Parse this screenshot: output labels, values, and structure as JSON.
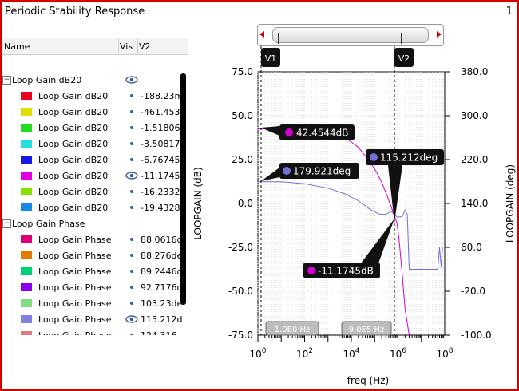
{
  "window": {
    "title": "Periodic Stability Response",
    "number": "1"
  },
  "tree": {
    "columns": {
      "name": "Name",
      "vis": "Vis",
      "v2": "V2"
    },
    "groups": [
      {
        "label": "Loop Gain dB20",
        "items": [
          {
            "label": "Loop Gain dB20",
            "color": "#e8001e",
            "value": "-188.23m"
          },
          {
            "label": "Loop Gain dB20",
            "color": "#e0e000",
            "value": "-461.453"
          },
          {
            "label": "Loop Gain dB20",
            "color": "#22dd22",
            "value": "-1.51806"
          },
          {
            "label": "Loop Gain dB20",
            "color": "#22e0e0",
            "value": "-3.50817"
          },
          {
            "label": "Loop Gain dB20",
            "color": "#1a1ae8",
            "value": "-6.76745"
          },
          {
            "label": "Loop Gain dB20",
            "color": "#e000e0",
            "value": "-11.1745c",
            "visible": true
          },
          {
            "label": "Loop Gain dB20",
            "color": "#88e000",
            "value": "-16.2332c"
          },
          {
            "label": "Loop Gain dB20",
            "color": "#1a88e8",
            "value": "-19.4328"
          }
        ]
      },
      {
        "label": "Loop Gain Phase",
        "items": [
          {
            "label": "Loop Gain Phase",
            "color": "#e0007a",
            "value": "88.0616d"
          },
          {
            "label": "Loop Gain Phase",
            "color": "#e07a00",
            "value": "88.276de"
          },
          {
            "label": "Loop Gain Phase",
            "color": "#00d07a",
            "value": "89.2446d"
          },
          {
            "label": "Loop Gain Phase",
            "color": "#8a00e8",
            "value": "92.7176d"
          },
          {
            "label": "Loop Gain Phase",
            "color": "#80e080",
            "value": "103.23de"
          },
          {
            "label": "Loop Gain Phase",
            "color": "#8080e0",
            "value": "115.212d",
            "visible": true
          },
          {
            "label": "Loop Gain Phase",
            "color": "#e07a7a",
            "value": "124.316"
          }
        ]
      }
    ]
  },
  "plot": {
    "markers": {
      "v1": "V1",
      "v2": "V2"
    },
    "labels": {
      "gain_low": "42.4544dB",
      "phase_low": "179.921deg",
      "phase_high": "115.212deg",
      "gain_high": "-11.1745dB",
      "scroll_left": "1.0E0 Hz",
      "scroll_right": "9.0E5 Hz"
    },
    "colors": {
      "gain": "#d000d0",
      "phase": "#7070d8"
    }
  },
  "chart_data": {
    "type": "line",
    "xlabel": "freq (Hz)",
    "ylabel": "LOOPGAIN (dB)",
    "y2label": "LOOPGAIN (deg)",
    "xscale": "log",
    "xlim": [
      1,
      100000000
    ],
    "ylim": [
      -75,
      75
    ],
    "y2lim": [
      -100,
      380
    ],
    "x_ticks": [
      "10^0",
      "10^2",
      "10^4",
      "10^6",
      "10^8"
    ],
    "y_ticks": [
      "75.0",
      "50.0",
      "25.0",
      "0.0",
      "-25.0",
      "-50.0",
      "-75.0"
    ],
    "y2_ticks": [
      "380.0",
      "300.0",
      "220.0",
      "140.0",
      "60.0",
      "-20.0",
      "-100.0"
    ],
    "grid": true,
    "series": [
      {
        "name": "Loop Gain dB20",
        "axis": "left",
        "x": [
          1,
          10,
          100,
          1000,
          5000,
          20000,
          60000,
          120000,
          200000,
          400000,
          900000,
          1100000,
          1500000,
          2000000,
          3000000
        ],
        "y": [
          42.45,
          42.45,
          42.3,
          41,
          38,
          32,
          24,
          18,
          12,
          2,
          -11.17,
          -20,
          -40,
          -60,
          -75
        ]
      },
      {
        "name": "Loop Gain Phase",
        "axis": "right",
        "x": [
          1,
          10,
          100,
          1000,
          5000,
          20000,
          60000,
          150000,
          300000,
          500000,
          900000,
          1500000,
          2000000,
          2500000,
          3000000,
          5000000,
          10000000,
          30000000,
          50000000,
          60000000,
          70000000,
          80000000
        ],
        "y": [
          179.9,
          179.5,
          176,
          168,
          158,
          145,
          130,
          121,
          120,
          126,
          115.2,
          116,
          128,
          120,
          20,
          20,
          20,
          20,
          20,
          60,
          25,
          60
        ]
      }
    ]
  }
}
